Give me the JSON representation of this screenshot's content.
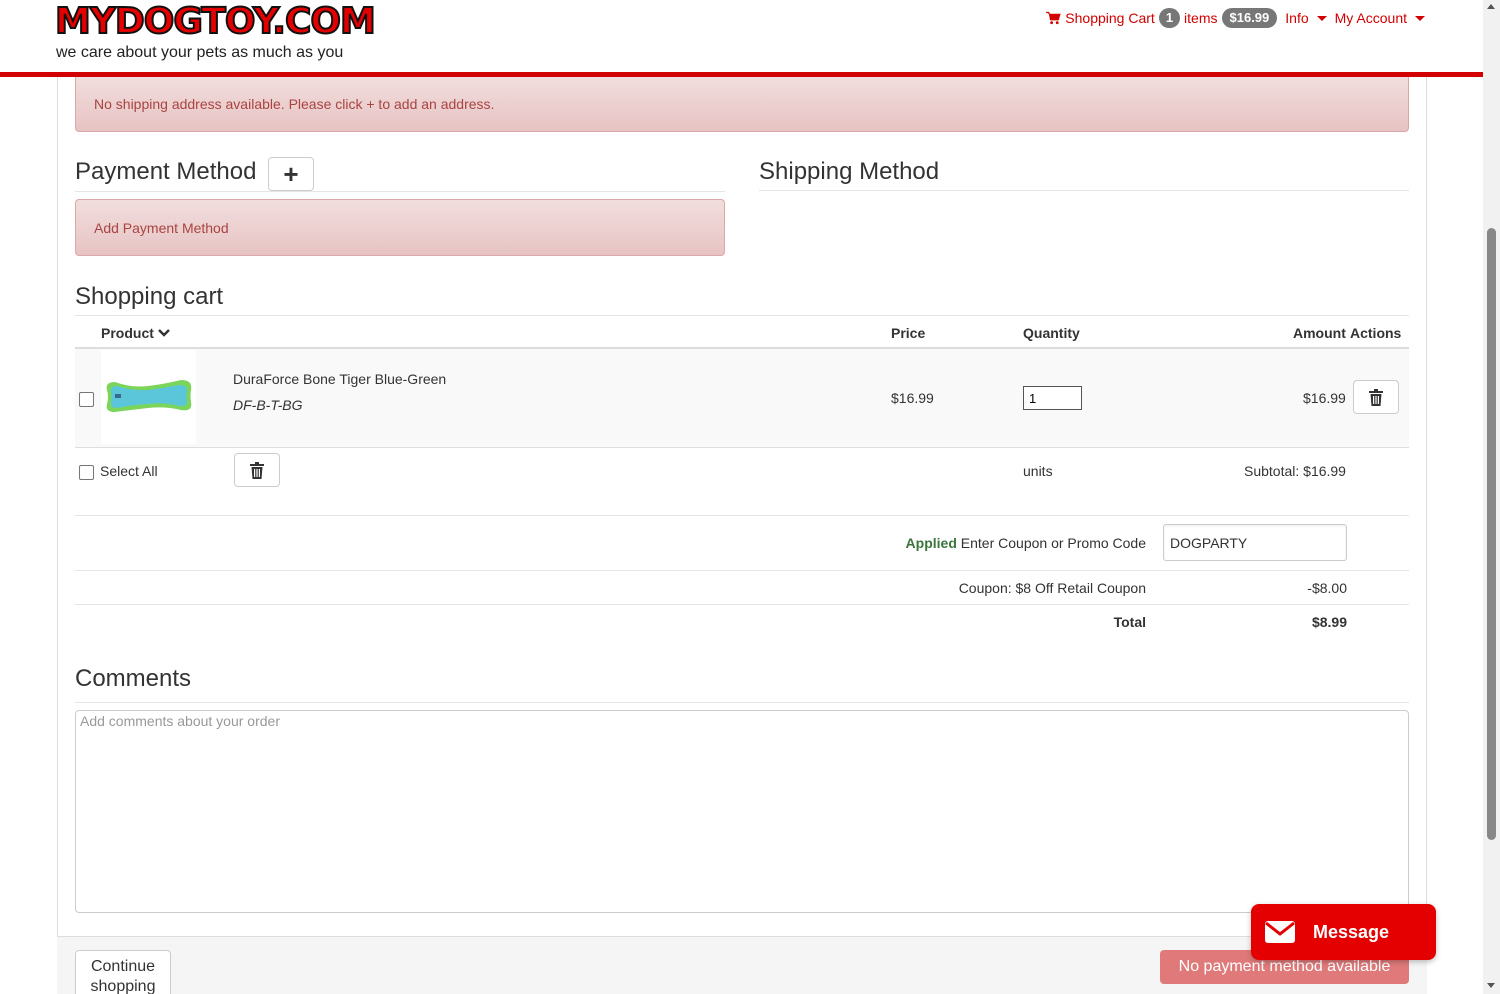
{
  "header": {
    "logo_text": "MYDOGTOY.COM",
    "tagline": "we care about your pets as much as you",
    "cart_label": "Shopping Cart",
    "cart_count": "1",
    "items_label": "items",
    "cart_total": "$16.99",
    "info_label": "Info",
    "account_label": "My Account"
  },
  "alerts": {
    "no_address": "No shipping address available. Please click + to add an address.",
    "add_payment": "Add Payment Method"
  },
  "sections": {
    "payment_method": "Payment Method",
    "shipping_method": "Shipping Method",
    "shopping_cart": "Shopping cart",
    "comments": "Comments"
  },
  "payment_add_symbol": "+",
  "cart": {
    "columns": {
      "product": "Product",
      "price": "Price",
      "quantity": "Quantity",
      "amount": "Amount",
      "actions": "Actions"
    },
    "items": [
      {
        "name": "DuraForce Bone Tiger Blue-Green",
        "sku": "DF-B-T-BG",
        "price": "$16.99",
        "quantity": "1",
        "amount": "$16.99"
      }
    ],
    "select_all": "Select All",
    "units_label": "units",
    "subtotal": "Subtotal: $16.99",
    "coupon": {
      "status": "Applied",
      "label": "Enter Coupon or Promo Code",
      "value": "DOGPARTY",
      "line_label": "Coupon: $8 Off Retail Coupon",
      "line_amount": "-$8.00"
    },
    "total_label": "Total",
    "total_amount": "$8.99"
  },
  "comments": {
    "placeholder": "Add comments about your order"
  },
  "footer": {
    "continue_label": "Continue shopping",
    "no_payment_label": "No payment method available",
    "message_label": "Message"
  },
  "colors": {
    "brand_red": "#d20000",
    "alert_bg": "#f2dede",
    "alert_text": "#a94442",
    "applied_green": "#3c763d",
    "badge_gray": "#777777"
  }
}
